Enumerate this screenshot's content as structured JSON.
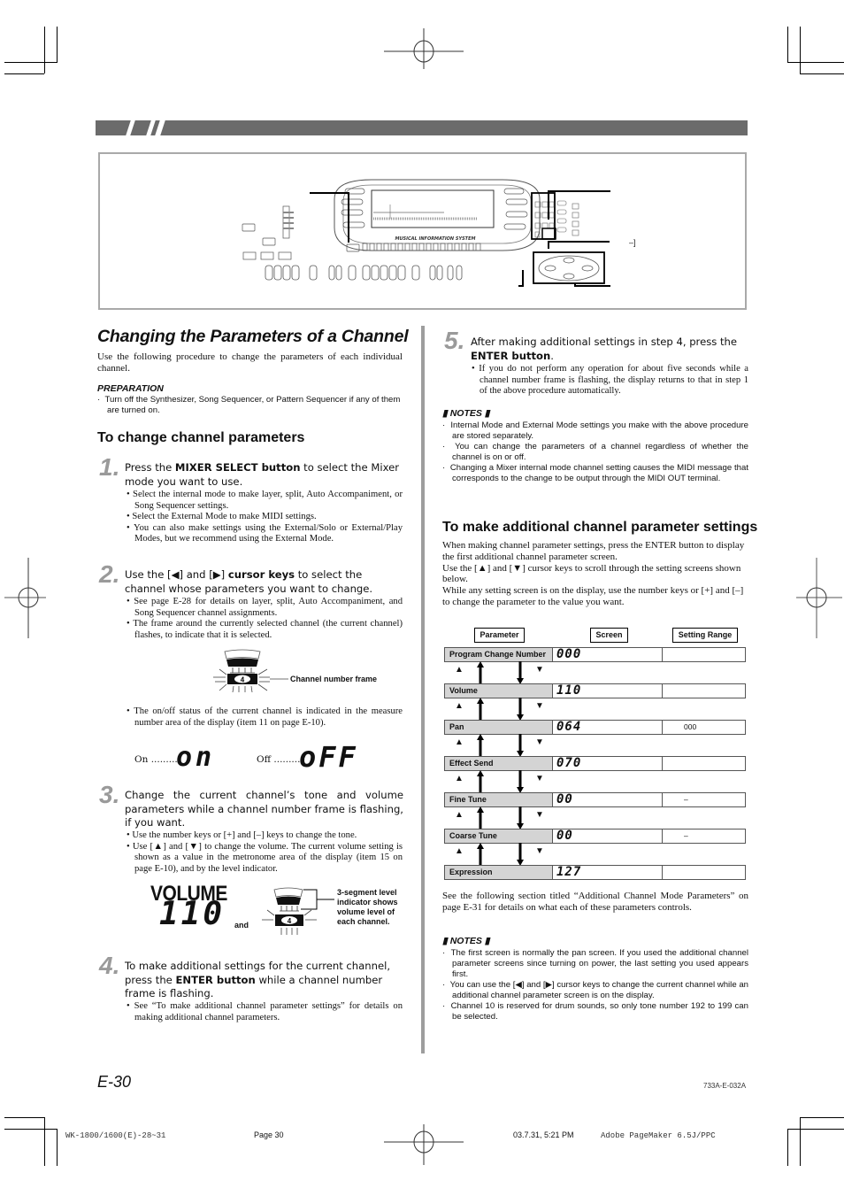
{
  "page": {
    "title": "Changing the Parameters of a Channel",
    "intro": "Use the following procedure to change the parameters of each individual channel.",
    "preparation": {
      "heading": "PREPARATION",
      "bullet": "Turn off the Synthesizer, Song Sequencer, or Pattern Sequencer if any of them are turned on."
    },
    "section1_heading": "To change channel parameters",
    "steps": [
      {
        "num": "1.",
        "pre": "Press the ",
        "bold": "MIXER SELECT button",
        "post": " to select the Mixer mode you want to use.",
        "bullets": [
          "Select the internal mode to make layer, split, Auto Accompaniment, or Song Sequencer settings.",
          "Select the External Mode to make MIDI settings.",
          "You can also make settings using the External/Solo or External/Play Modes, but we recommend using the External Mode."
        ]
      },
      {
        "num": "2.",
        "pre": "Use the [◀] and [▶] ",
        "bold": "cursor keys",
        "post": " to select the channel whose parameters you want to change.",
        "bullets": [
          "See page E-28 for details on layer, split, Auto Accompaniment, and Song Sequencer channel assignments.",
          "The frame around the currently selected channel (the current channel) flashes, to indicate that it is selected."
        ]
      },
      {
        "num": "3.",
        "pre": "Change the current channel’s tone and volume parameters while a channel number frame is flashing, if you want.",
        "bold": "",
        "post": "",
        "bullets": [
          "Use the number keys or [+] and [–] keys to change the tone.",
          "Use [▲] and [▼] to change the volume. The current volume setting is shown as a value in the metronome area of the display (item 15 on page E-10), and by the level indicator."
        ]
      },
      {
        "num": "4.",
        "pre": "To make additional settings for the current channel, press the ",
        "bold": "ENTER button",
        "post": " while a channel number frame is flashing.",
        "bullets": [
          "See “To make additional channel parameter settings” for details on making additional channel parameters."
        ]
      },
      {
        "num": "5.",
        "pre": "After making additional settings in step 4, press the ",
        "bold": "ENTER button",
        "post": ".",
        "bullets": [
          "If you do not perform any operation for about five seconds while a channel number frame is flashing, the display returns to that in step 1 of the above procedure automatically."
        ]
      }
    ],
    "channel_frame": {
      "number": "4",
      "label": "Channel number frame"
    },
    "on_off_note": "The on/off status of the current channel is indicated in the measure number area of the display (item 11 on page E-10).",
    "on_off": {
      "on_label": "On .........",
      "on_lcd": "on",
      "off_label": "Off .........",
      "off_lcd": "oFF"
    },
    "volume_display": {
      "label": "VOLUME",
      "value": "110",
      "and": "and",
      "level_number": "4",
      "level_caption": "3-segment level indicator shows volume level of each channel."
    },
    "notes1": {
      "heading": "NOTES",
      "items": [
        "Internal Mode and External Mode settings you make with the above procedure are stored separately.",
        "You can change the parameters of a channel regardless of whether the channel is on or off.",
        "Changing a Mixer internal mode channel setting causes the MIDI message that corresponds to the change to be output through the MIDI OUT terminal."
      ]
    },
    "section2_heading": "To make additional channel parameter settings",
    "section2_paras": [
      "When making channel parameter settings, press the ENTER button to display the first additional channel parameter screen.",
      "Use the [▲] and [▼] cursor keys to scroll through the setting screens shown below.",
      "While any setting screen is on the display, use the number keys or [+] and [–] to change the parameter to the value you want."
    ],
    "table": {
      "headers": [
        "Parameter",
        "Screen",
        "Setting Range"
      ],
      "rows": [
        {
          "param": "Program Change Number",
          "screen": "000",
          "range": ""
        },
        {
          "param": "Volume",
          "screen": "110",
          "range": ""
        },
        {
          "param": "Pan",
          "screen": "064",
          "range": "000"
        },
        {
          "param": "Effect Send",
          "screen": "070",
          "range": ""
        },
        {
          "param": "Fine Tune",
          "screen": "00",
          "range": "–"
        },
        {
          "param": "Coarse Tune",
          "screen": "00",
          "range": "–"
        },
        {
          "param": "Expression",
          "screen": "127",
          "range": ""
        }
      ],
      "up_symbol": "▲",
      "down_symbol": "▼"
    },
    "see_following": "See the following section titled “Additional Channel Mode Parameters” on page E-31 for details on what each of these parameters controls.",
    "notes2": {
      "heading": "NOTES",
      "items": [
        "The first screen is normally the pan screen. If you used the additional channel parameter screens since turning on power, the last setting you used appears first.",
        "You can use the [◀] and [▶] cursor keys to change the current channel while an additional channel parameter screen is on the display.",
        "Channel 10 is reserved for drum sounds, so only tone number 192 to 199 can be selected."
      ]
    },
    "page_number": "E-30",
    "doc_code": "733A-E-032A",
    "keyboard_diagram": {
      "display_caption": "MUSICAL INFORMATION SYSTEM",
      "callout_label": "–]"
    }
  },
  "footer": {
    "file": "WK-1800/1600(E)-28~31",
    "page": "Page 30",
    "date": "03.7.31, 5:21 PM",
    "app": "Adobe PageMaker 6.5J/PPC"
  }
}
